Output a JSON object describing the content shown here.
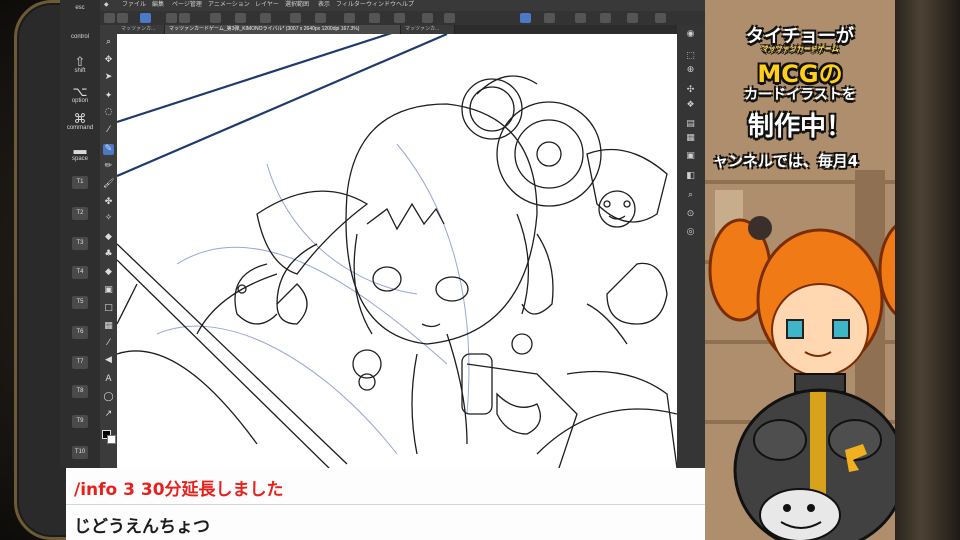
{
  "menu": {
    "items": [
      "ファイル",
      "編集",
      "ページ管理",
      "アニメーション",
      "レイヤー",
      "選択範囲",
      "表示",
      "フィルター",
      "ウィンドウ",
      "ヘルプ"
    ]
  },
  "tabs": [
    {
      "label": "マッツァンカ..."
    },
    {
      "label": "マッツァンカードゲーム_第3弾_KIMONOライバル* (3007 x 2640px 1200dpi 167.3%)"
    },
    {
      "label": "マッツァンカ..."
    }
  ],
  "shortcut_panel": {
    "items": [
      {
        "label": "esc",
        "symbol": ""
      },
      {
        "label": "control",
        "symbol": ""
      },
      {
        "label": "shift",
        "symbol": "⇧"
      },
      {
        "label": "option",
        "symbol": "⌥"
      },
      {
        "label": "command",
        "symbol": "⌘"
      },
      {
        "label": "space",
        "symbol": "▬"
      }
    ],
    "toggles": [
      "T1",
      "T2",
      "T3",
      "T4",
      "T5",
      "T6",
      "T7",
      "T8",
      "T9",
      "T10"
    ]
  },
  "chat": {
    "line1": "/info 3 30分延長しました",
    "line2": "じどうえんちょつ"
  },
  "banner": {
    "title_line1": "タイチョーが",
    "title_sub": "マッツァンカードゲーム",
    "title_line2": "MCGの",
    "title_line3": "カードイラストを",
    "title_line4": "制作中！",
    "ticker": "ャンネルでは、毎月4"
  },
  "colors": {
    "accent": "#4b79c8",
    "chat_red": "#e8201c",
    "bezel_gold": "#6e5a34",
    "navy_line": "#1f3a6e"
  }
}
